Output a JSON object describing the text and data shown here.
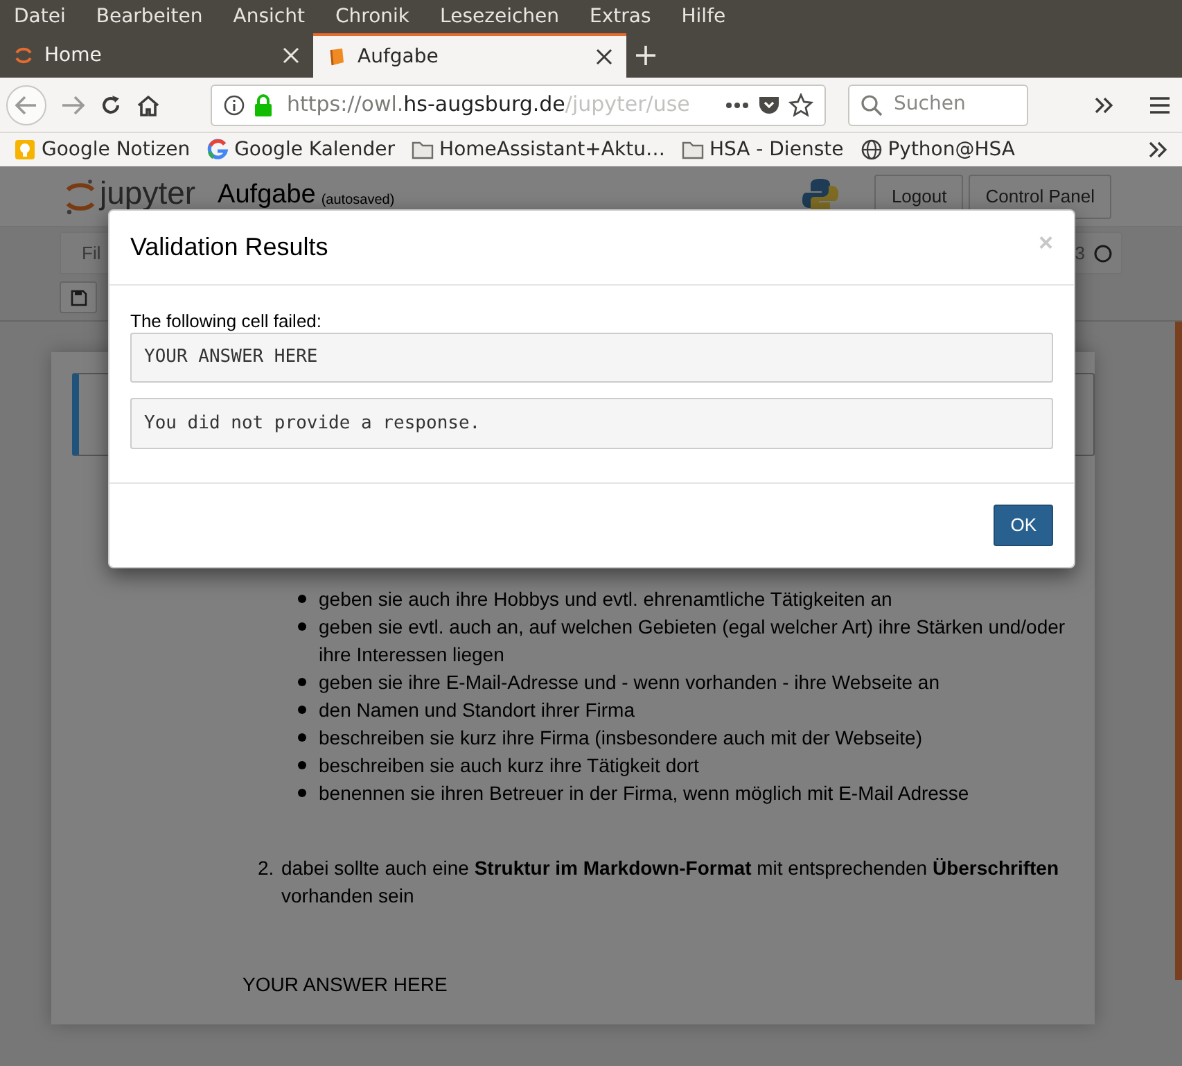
{
  "browser": {
    "menu": [
      "Datei",
      "Bearbeiten",
      "Ansicht",
      "Chronik",
      "Lesezeichen",
      "Extras",
      "Hilfe"
    ],
    "tabs": [
      {
        "title": "Home",
        "selected": false
      },
      {
        "title": "Aufgabe",
        "selected": true
      }
    ],
    "url": {
      "prefix": "https://owl.",
      "domain": "hs-augsburg.de",
      "path": "/jupyter/use"
    },
    "search_placeholder": "Suchen",
    "bookmarks": [
      {
        "label": "Google Notizen",
        "kind": "notes"
      },
      {
        "label": "Google Kalender",
        "kind": "google"
      },
      {
        "label": "HomeAssistant+Aktu…",
        "kind": "folder"
      },
      {
        "label": "HSA - Dienste",
        "kind": "folder"
      },
      {
        "label": "Python@HSA",
        "kind": "globe"
      }
    ]
  },
  "notebook": {
    "logo": "jupyter",
    "title": "Aufgabe",
    "save_status": "(autosaved)",
    "buttons": [
      "Logout",
      "Control Panel"
    ],
    "menu_partial": "Fil",
    "kernel_partial": "3",
    "bullets": [
      "geben sie auch ihre Hobbys und evtl. ehrenamtliche Tätigkeiten an",
      "geben sie evtl. auch an, auf welchen Gebieten (egal welcher Art) ihre Stärken und/oder ihre Interessen liegen",
      "geben sie ihre E-Mail-Adresse und - wenn vorhanden - ihre Webseite an",
      "den Namen und Standort ihrer Firma",
      "beschreiben sie kurz ihre Firma (insbesondere auch mit der Webseite)",
      "beschreiben sie auch kurz ihre Tätigkeit dort",
      "benennen sie ihren Betreuer in der Firma, wenn möglich mit E-Mail Adresse"
    ],
    "numbered": {
      "number": "2.",
      "text": "dabei sollte auch eine **Struktur im Markdown-Format** mit entsprechenden **Überschriften** vorhanden sein"
    },
    "answer": "YOUR ANSWER HERE"
  },
  "dialog": {
    "title": "Validation Results",
    "close": "×",
    "intro": "The following cell failed:",
    "cell_source": "YOUR ANSWER HERE",
    "error": "You did not provide a response.",
    "button": "OK"
  }
}
